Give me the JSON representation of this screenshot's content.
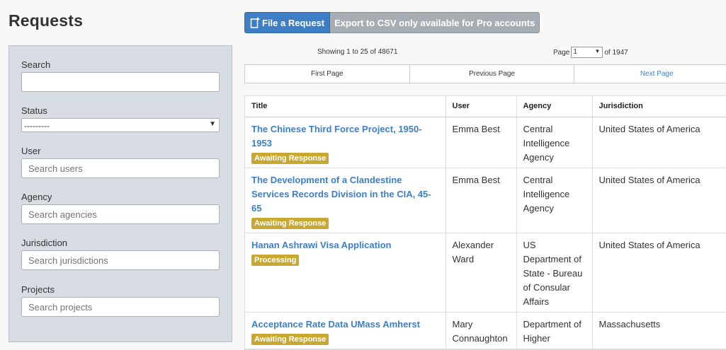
{
  "header": {
    "title": "Requests"
  },
  "toolbar": {
    "file_label": "File a Request",
    "export_label": "Export to CSV only available for Pro accounts"
  },
  "sidebar": {
    "search_label": "Search",
    "search_value": "",
    "status_label": "Status",
    "status_selected": "---------",
    "user_label": "User",
    "user_placeholder": "Search users",
    "agency_label": "Agency",
    "agency_placeholder": "Search agencies",
    "jurisdiction_label": "Jurisdiction",
    "jurisdiction_placeholder": "Search jurisdictions",
    "projects_label": "Projects",
    "projects_placeholder": "Search projects"
  },
  "pagination": {
    "showing": "Showing 1 to 25 of 48671",
    "page_label": "Page",
    "page_value": "1",
    "of_total": "of 1947",
    "first": "First Page",
    "previous": "Previous Page",
    "next": "Next Page"
  },
  "table": {
    "headers": [
      "Title",
      "User",
      "Agency",
      "Jurisdiction"
    ],
    "rows": [
      {
        "title": "The Chinese Third Force Project, 1950-1953",
        "status": "Awaiting Response",
        "user": "Emma Best",
        "agency": "Central Intelligence Agency",
        "jurisdiction": "United States of America"
      },
      {
        "title": "The Development of a Clandestine Services Records Division in the CIA, 45-65",
        "status": "Awaiting Response",
        "user": "Emma Best",
        "agency": "Central Intelligence Agency",
        "jurisdiction": "United States of America"
      },
      {
        "title": "Hanan Ashrawi Visa Application",
        "status": "Processing",
        "user": "Alexander Ward",
        "agency": "US Department of State - Bureau of Consular Affairs",
        "jurisdiction": "United States of America"
      },
      {
        "title": "Acceptance Rate Data UMass Amherst",
        "status": "Awaiting Response",
        "user": "Mary Connaughton",
        "agency": "Department of Higher",
        "jurisdiction": "Massachusetts"
      }
    ]
  },
  "colors": {
    "accent": "#3e7ec5",
    "badge": "#c9a832",
    "sidebar_bg": "#d8dde3"
  }
}
